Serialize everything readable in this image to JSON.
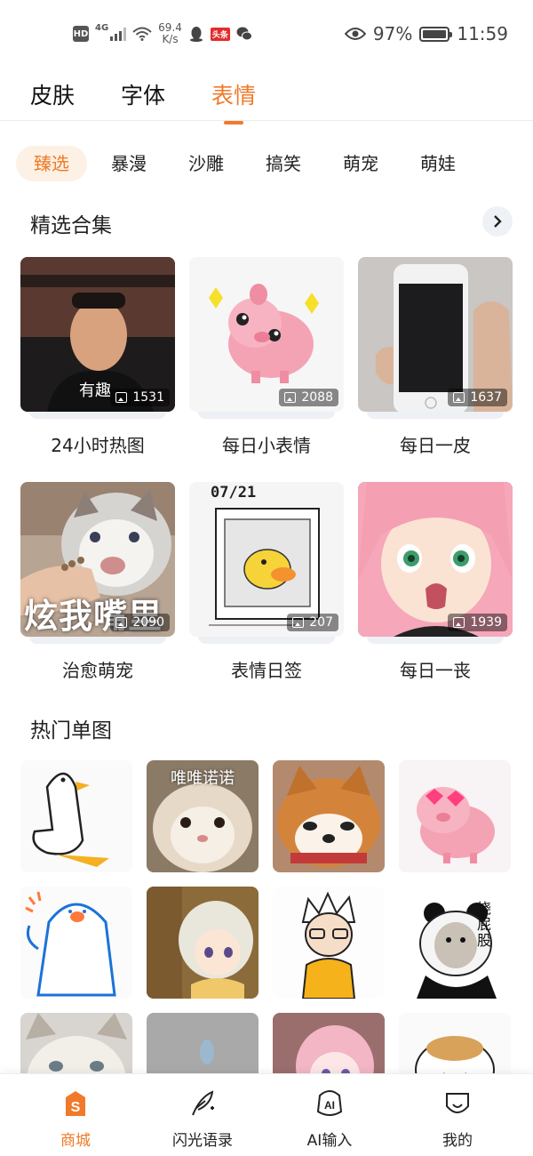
{
  "status_bar": {
    "hd": "HD",
    "network": "4G",
    "speed_value": "69.4",
    "speed_unit": "K/s",
    "toutiao": "头条",
    "battery": "97%",
    "time": "11:59",
    "battery_level": 0.97
  },
  "main_tabs": [
    "皮肤",
    "字体",
    "表情"
  ],
  "sub_tabs": [
    "臻选",
    "暴漫",
    "沙雕",
    "搞笑",
    "萌宠",
    "萌娃"
  ],
  "featured": {
    "title": "精选合集",
    "items": [
      {
        "title": "24小时热图",
        "count": "1531",
        "overlay": "有趣"
      },
      {
        "title": "每日小表情",
        "count": "2088"
      },
      {
        "title": "每日一皮",
        "count": "1637"
      },
      {
        "title": "治愈萌宠",
        "count": "2090",
        "overlay": "炫我嘴里"
      },
      {
        "title": "表情日签",
        "count": "207",
        "date": "07/21"
      },
      {
        "title": "每日一丧",
        "count": "1939"
      }
    ]
  },
  "hot": {
    "title": "热门单图",
    "captions": {
      "hamster": "唯唯诺诺",
      "panda": "挠屁股"
    }
  },
  "bottom_nav": [
    {
      "label": "商城",
      "icon": "shop-icon"
    },
    {
      "label": "闪光语录",
      "icon": "quill-icon"
    },
    {
      "label": "AI输入",
      "icon": "ai-icon"
    },
    {
      "label": "我的",
      "icon": "profile-icon"
    }
  ],
  "colors": {
    "accent": "#f07a2a",
    "accent_bg": "#fdf0e4"
  }
}
